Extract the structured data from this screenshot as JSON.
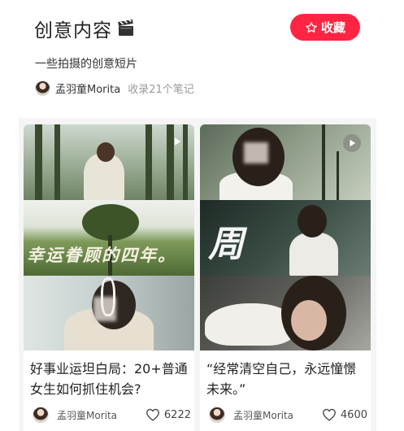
{
  "header": {
    "title": "创意内容",
    "title_icon": "clapper-board-icon",
    "collect_label": "收藏",
    "collect_icon": "star-outline-icon",
    "description": "一些拍摄的创意短片",
    "author_name": "孟羽童Morita",
    "note_count": "收录21个笔记"
  },
  "colors": {
    "accent": "#ff2442",
    "feed_background": "#f5f5f5"
  },
  "cards": [
    {
      "title": "好事业运坦白局：20+普通女生如何抓住机会?",
      "cover_text": "幸运眷顾的四年。",
      "author": "孟羽童Morita",
      "likes": "6222"
    },
    {
      "title": "“经常清空自己，永远憧憬未来。”",
      "cover_text": "周游",
      "author": "孟羽童Morita",
      "likes": "4600"
    }
  ]
}
